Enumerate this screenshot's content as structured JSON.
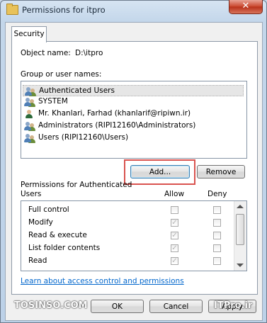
{
  "window": {
    "title": "Permissions for itpro",
    "close_glyph": "✕"
  },
  "tabs": [
    {
      "label": "Security"
    }
  ],
  "object": {
    "label": "Object name:",
    "value": "D:\\itpro"
  },
  "group_label": "Group or user names:",
  "users": [
    {
      "label": "Authenticated Users",
      "icon": "users-group-icon",
      "selected": true
    },
    {
      "label": "SYSTEM",
      "icon": "users-group-icon",
      "selected": false
    },
    {
      "label": "Mr. Khanlari, Farhad (khanlarif@ripiwn.ir)",
      "icon": "user-icon",
      "selected": false
    },
    {
      "label": "Administrators (RIPI12160\\Administrators)",
      "icon": "users-group-icon",
      "selected": false
    },
    {
      "label": "Users (RIPI12160\\Users)",
      "icon": "users-group-icon",
      "selected": false
    }
  ],
  "buttons": {
    "add": "Add...",
    "remove": "Remove",
    "ok": "OK",
    "cancel": "Cancel",
    "apply": "Apply"
  },
  "permissions": {
    "label_line1": "Permissions for Authenticated",
    "label_line2": "Users",
    "allow_header": "Allow",
    "deny_header": "Deny",
    "rows": [
      {
        "name": "Full control",
        "allow": false,
        "deny": false
      },
      {
        "name": "Modify",
        "allow": true,
        "deny": false
      },
      {
        "name": "Read & execute",
        "allow": true,
        "deny": false
      },
      {
        "name": "List folder contents",
        "allow": true,
        "deny": false
      },
      {
        "name": "Read",
        "allow": true,
        "deny": false
      }
    ]
  },
  "link_text": "Learn about access control and permissions",
  "watermarks": {
    "left": "TOSINSO.COM",
    "right": "ITPro.ir"
  },
  "colors": {
    "highlight": "#d9534f",
    "link": "#0066cc"
  }
}
